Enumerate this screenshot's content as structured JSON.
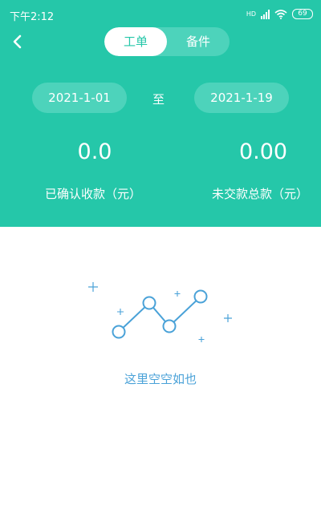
{
  "status": {
    "time": "下午2:12",
    "signal_label": "HD",
    "battery": "69"
  },
  "tabs": [
    {
      "label": "工单",
      "active": true
    },
    {
      "label": "备件",
      "active": false
    }
  ],
  "date_range": {
    "from": "2021-1-01",
    "separator": "至",
    "to": "2021-1-19"
  },
  "summary": {
    "confirmed_amount": "0.0",
    "confirmed_label": "已确认收款（元）",
    "unpaid_amount": "0.00",
    "unpaid_label": "未交款总款（元）"
  },
  "empty_state": {
    "message": "这里空空如也"
  },
  "colors": {
    "primary": "#25c7a9",
    "pill": "#4dd3bb",
    "empty_illustration": "#4aa2d8"
  }
}
